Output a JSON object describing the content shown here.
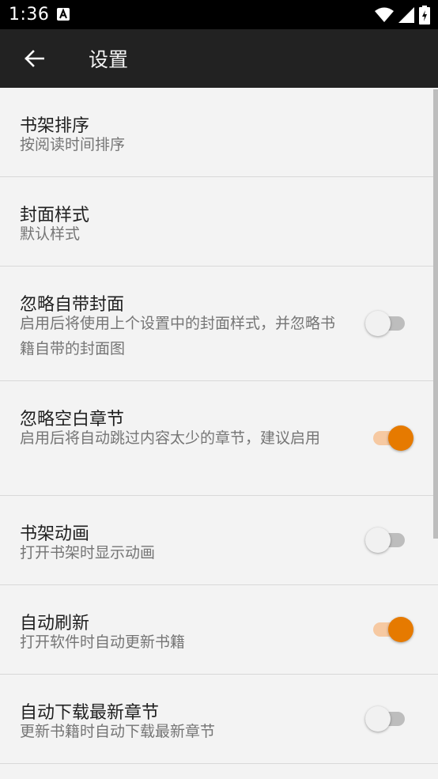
{
  "status": {
    "time": "1:36"
  },
  "app_bar": {
    "title": "设置"
  },
  "settings": [
    {
      "title": "书架排序",
      "subtitle": "按阅读时间排序"
    },
    {
      "title": "封面样式",
      "subtitle": "默认样式"
    },
    {
      "title": "忽略自带封面",
      "subtitle": "启用后将使用上个设置中的封面样式，并忽略书籍自带的封面图",
      "toggle": false
    },
    {
      "title": "忽略空白章节",
      "subtitle": "启用后将自动跳过内容太少的章节，建议启用",
      "toggle": true
    },
    {
      "title": "书架动画",
      "subtitle": "打开书架时显示动画",
      "toggle": false
    },
    {
      "title": "自动刷新",
      "subtitle": "打开软件时自动更新书籍",
      "toggle": true
    },
    {
      "title": "自动下载最新章节",
      "subtitle": "更新书籍时自动下载最新章节",
      "toggle": false
    }
  ],
  "colors": {
    "accent": "#e67a00",
    "app_bar": "#222222",
    "background": "#f3f3f3"
  }
}
